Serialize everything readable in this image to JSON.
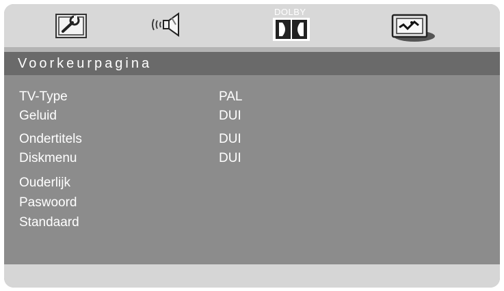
{
  "tabs": [
    {
      "name": "general-setup",
      "icon": "wrench-icon"
    },
    {
      "name": "audio-setup",
      "icon": "speaker-icon"
    },
    {
      "name": "dolby-setup",
      "icon": "dolby-icon",
      "label": "DOLBY"
    },
    {
      "name": "preference-setup",
      "icon": "preference-icon"
    }
  ],
  "page": {
    "title": "Voorkeurpagina"
  },
  "menu": {
    "items": [
      {
        "label": "TV-Type",
        "value": "PAL"
      },
      {
        "label": "Geluid",
        "value": "DUI"
      },
      {
        "label": "Ondertitels",
        "value": "DUI"
      },
      {
        "label": "Diskmenu",
        "value": "DUI"
      },
      {
        "label": "Ouderlijk",
        "value": ""
      },
      {
        "label": "Paswoord",
        "value": ""
      },
      {
        "label": "Standaard",
        "value": ""
      }
    ]
  }
}
